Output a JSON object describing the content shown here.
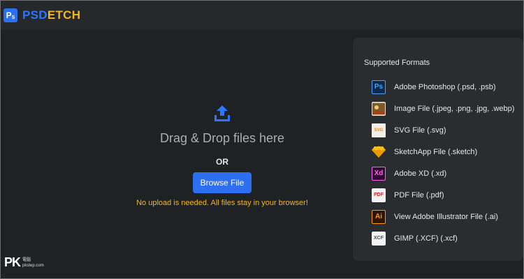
{
  "navbar": {
    "logo_badge": "P",
    "logo_badge_sub": "S",
    "brand_part1": "PSD",
    "brand_part2": "ETCH"
  },
  "dropzone": {
    "icon": "upload-icon",
    "drag_text": "Drag & Drop files here",
    "or_text": "OR",
    "browse_label": "Browse File",
    "note": "No upload is needed. All files stay in your browser!"
  },
  "formats": {
    "title": "Supported Formats",
    "items": [
      {
        "icon": "photoshop-icon",
        "badge": "Ps",
        "label": "Adobe Photoshop (.psd, .psb)"
      },
      {
        "icon": "image-file-icon",
        "badge": "",
        "label": "Image File (.jpeg, .png, .jpg, .webp)"
      },
      {
        "icon": "svg-file-icon",
        "badge": "SVG",
        "label": "SVG File (.svg)"
      },
      {
        "icon": "sketch-icon",
        "badge": "",
        "label": "SketchApp File (.sketch)"
      },
      {
        "icon": "adobe-xd-icon",
        "badge": "Xd",
        "label": "Adobe XD (.xd)"
      },
      {
        "icon": "pdf-file-icon",
        "badge": "PDF",
        "label": "PDF File (.pdf)"
      },
      {
        "icon": "illustrator-icon",
        "badge": "Ai",
        "label": "View Adobe Illustrator File (.ai)"
      },
      {
        "icon": "gimp-file-icon",
        "badge": "XCF",
        "label": "GIMP (.XCF) (.xcf)"
      }
    ]
  },
  "watermark": {
    "main": "PK",
    "line1": "電腦",
    "line2": "pkstep.com"
  },
  "colors": {
    "accent_blue": "#2d6ff0",
    "accent_yellow": "#f2b71f",
    "background": "#1f2224",
    "panel": "#2a2d30"
  }
}
